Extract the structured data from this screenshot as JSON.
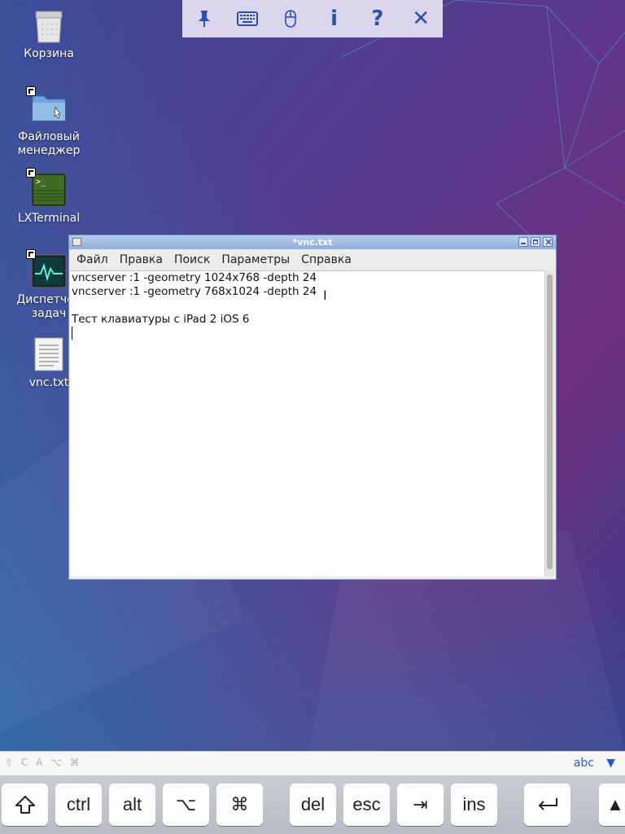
{
  "vnc_toolbar": {
    "icons": [
      "pin-icon",
      "keyboard-icon",
      "mouse-icon",
      "info-icon",
      "help-icon",
      "close-icon"
    ],
    "info_glyph": "i",
    "help_glyph": "?",
    "close_glyph": "✕",
    "accent": "#2a4fb0"
  },
  "desktop": {
    "icons": [
      {
        "name": "trash",
        "label": "Корзина"
      },
      {
        "name": "file-manager",
        "label": "Файловый менеджер"
      },
      {
        "name": "lxterminal",
        "label": "LXTerminal"
      },
      {
        "name": "task-manager",
        "label": "Диспетчер задач"
      },
      {
        "name": "vnc-txt",
        "label": "vnc.txt"
      }
    ]
  },
  "window": {
    "title": "*vnc.txt",
    "menu": [
      "Файл",
      "Правка",
      "Поиск",
      "Параметры",
      "Справка"
    ],
    "lines": [
      "vncserver :1 -geometry 1024x768 -depth 24",
      "vncserver :1 -geometry 768x1024 -depth 24",
      "",
      "Тест клавиатуры с iPad 2 iOS 6",
      ""
    ]
  },
  "keyboard_bar": {
    "modifiers": "⇧ C A ⌥ ⌘",
    "mode": "abc",
    "hide_glyph": "▼"
  },
  "keyboard_keys": [
    "⇧",
    "ctrl",
    "alt",
    "⌥",
    "⌘",
    "del",
    "esc",
    "⇥",
    "ins",
    "↵",
    "▲"
  ],
  "colors": {
    "link": "#2a5bd7",
    "titlebar": "#8fafd9"
  }
}
